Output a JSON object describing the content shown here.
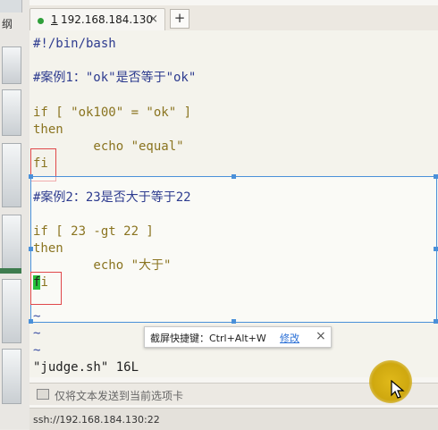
{
  "tab": {
    "index": "1",
    "title": "192.168.184.130",
    "close": "×"
  },
  "new_tab": "+",
  "editor_lines": {
    "l1": "#!/bin/bash",
    "l3": "#案例1：\"ok\"是否等于\"ok\"",
    "l5": "if [ \"ok100\" = \"ok\" ]",
    "l6": "then",
    "l7": "        echo \"equal\"",
    "l8": "fi",
    "l9": "#案例2：23是否大于等于22",
    "l11": "if [ 23 -gt 22 ]",
    "l12": "then",
    "l13": "        echo \"大于\"",
    "l14_cursor": "f",
    "l14_rest": "i",
    "tilde": "~",
    "status": "\"judge.sh\" 16L"
  },
  "tooltip": {
    "text": "截屏快捷键：Ctrl+Alt+W",
    "link": "修改",
    "close": "×"
  },
  "cmdbar": {
    "text": "仅将文本发送到当前选项卡"
  },
  "statusbar": {
    "text": "ssh://192.168.184.130:22"
  },
  "left_strip": {
    "char": "纲"
  },
  "colors": {
    "selection": "#4a90d9",
    "annotation": "#e0484a",
    "cursor": "#27c13a",
    "keyword": "#8a7420",
    "comment": "#2d3b8f"
  }
}
